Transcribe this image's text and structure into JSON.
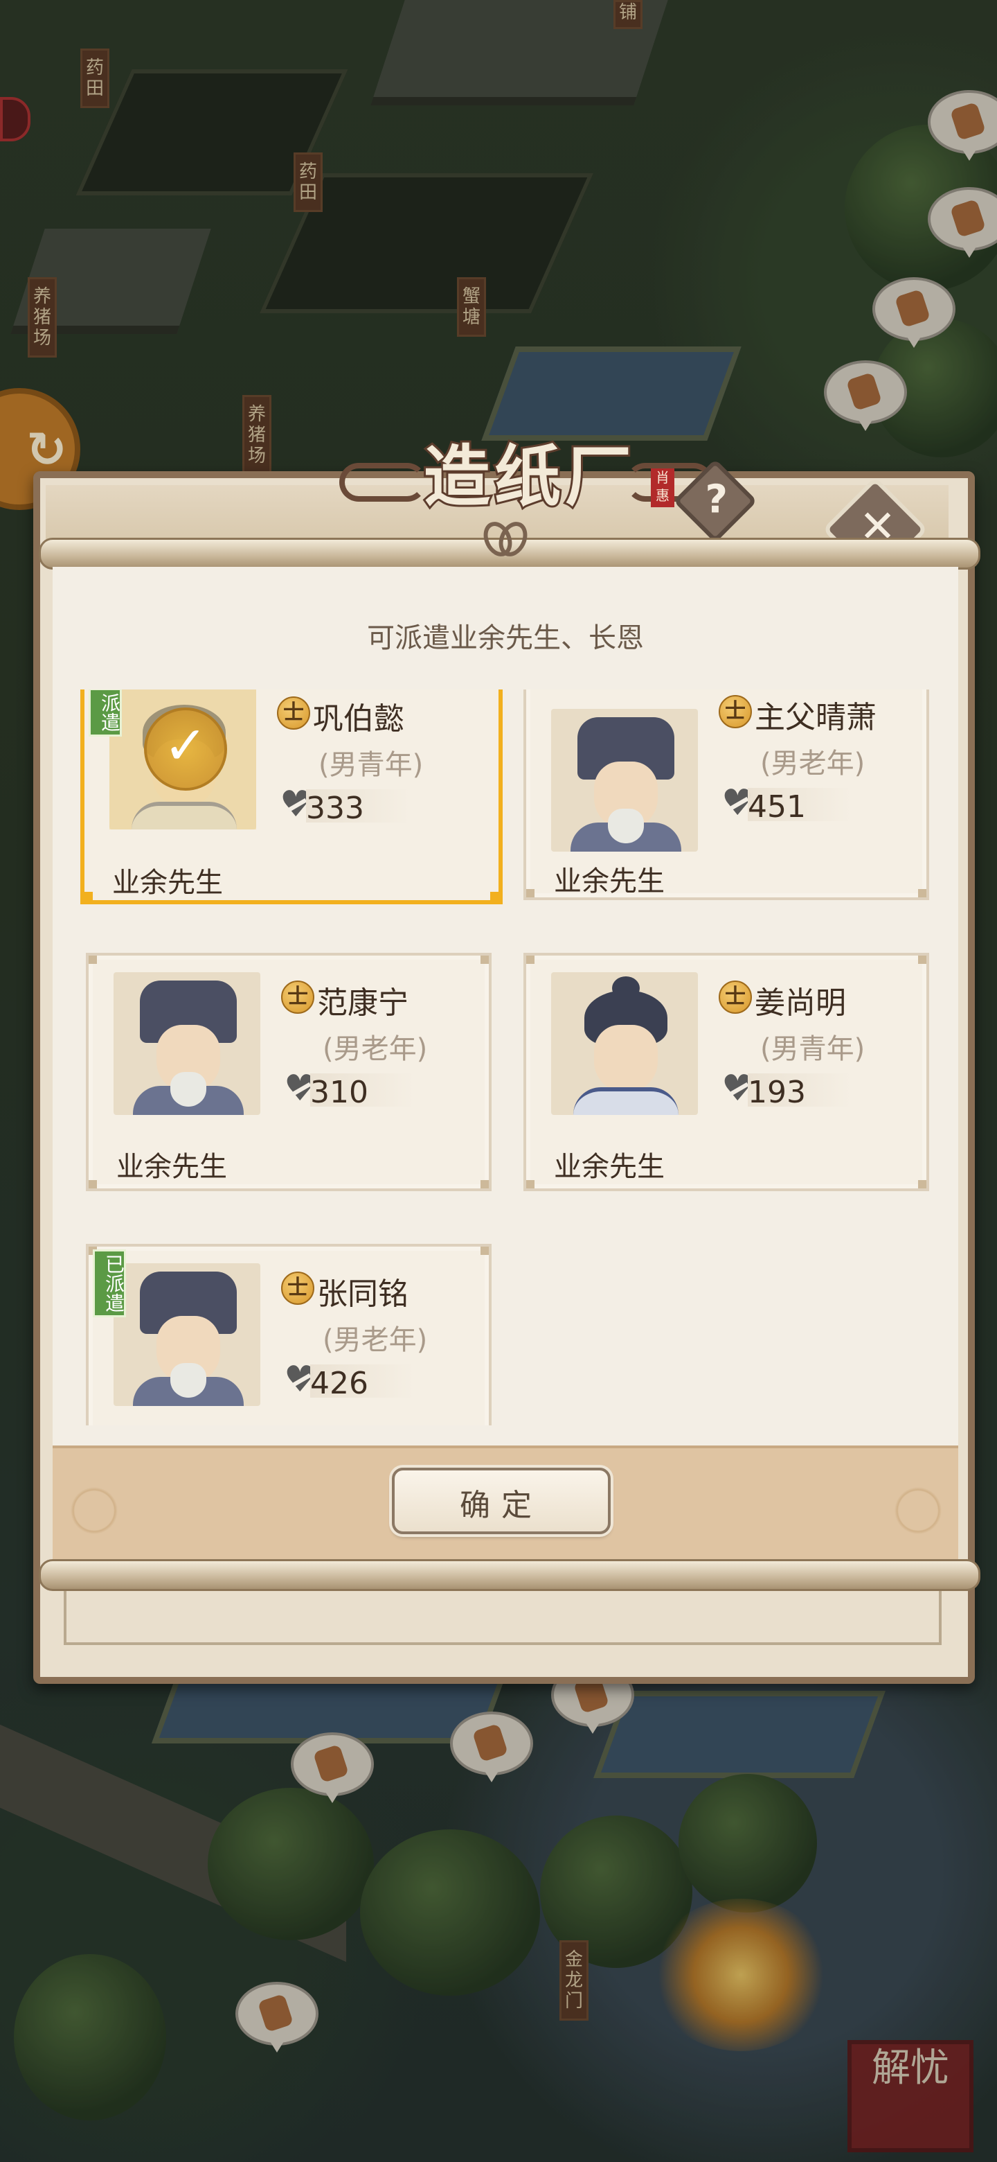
{
  "map": {
    "signs": [
      "药田",
      "药田",
      "养猪场",
      "养猪场",
      "蟹塘",
      "金龙门",
      "铺"
    ],
    "corner_seal": "解忧"
  },
  "modal": {
    "title": "造纸厂",
    "title_seal": "肖惠",
    "help_label": "?",
    "close_label": "✕",
    "subtitle": "可派遣业余先生、长恩",
    "confirm_label": "确定",
    "rank_glyph": "士",
    "cards": [
      {
        "name": "巩伯懿",
        "desc": "(男青年)",
        "value": "333",
        "role": "业余先生",
        "tag": "派遣",
        "selected": true
      },
      {
        "name": "主父晴萧",
        "desc": "(男老年)",
        "value": "451",
        "role": "业余先生"
      },
      {
        "name": "范康宁",
        "desc": "(男老年)",
        "value": "310",
        "role": "业余先生"
      },
      {
        "name": "姜尚明",
        "desc": "(男青年)",
        "value": "193",
        "role": "业余先生"
      },
      {
        "name": "张同铭",
        "desc": "(男老年)",
        "value": "426",
        "role": "",
        "tag": "已派遣"
      }
    ]
  },
  "colors": {
    "selected_border": "#f2b01e",
    "tag_green": "#5b9a45",
    "frame_brown": "#8a6f55"
  },
  "icons": [
    "gold-coin-icon",
    "heart-charm-icon",
    "check-icon",
    "help-icon",
    "close-icon"
  ]
}
